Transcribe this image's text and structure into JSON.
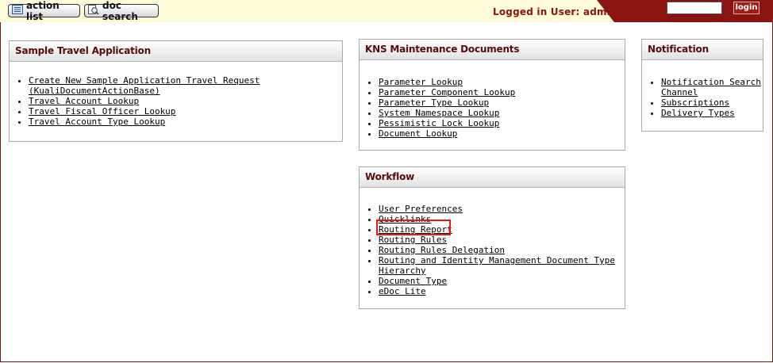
{
  "toolbar": {
    "action_list_label": "action list",
    "doc_search_label": "doc search",
    "logged_in_text": "Logged in User: admin",
    "login_label": "login",
    "login_input_value": ""
  },
  "sections": {
    "sample_travel": {
      "title": "Sample Travel Application",
      "items": [
        "Create New Sample Application Travel Request (KualiDocumentActionBase)",
        "Travel Account Lookup",
        "Travel Fiscal Officer Lookup",
        "Travel Account Type Lookup"
      ]
    },
    "kns": {
      "title": "KNS Maintenance Documents",
      "items": [
        "Parameter Lookup",
        "Parameter Component Lookup",
        "Parameter Type Lookup",
        "System Namespace Lookup",
        "Pessimistic Lock Lookup",
        "Document Lookup"
      ]
    },
    "notification": {
      "title": "Notification",
      "items": [
        "Notification Search",
        "Channel Subscriptions",
        "Delivery Types"
      ]
    },
    "workflow": {
      "title": "Workflow",
      "items": [
        "User Preferences",
        "Quicklinks",
        "Routing Report",
        "Routing Rules",
        "Routing Rules Delegation",
        "Routing and Identity Management Document Type Hierarchy",
        "Document Type",
        "eDoc Lite"
      ]
    }
  },
  "colors": {
    "brand_red": "#8a1410",
    "topbar_bg": "#fffcd9",
    "highlight": "#e5191a"
  }
}
